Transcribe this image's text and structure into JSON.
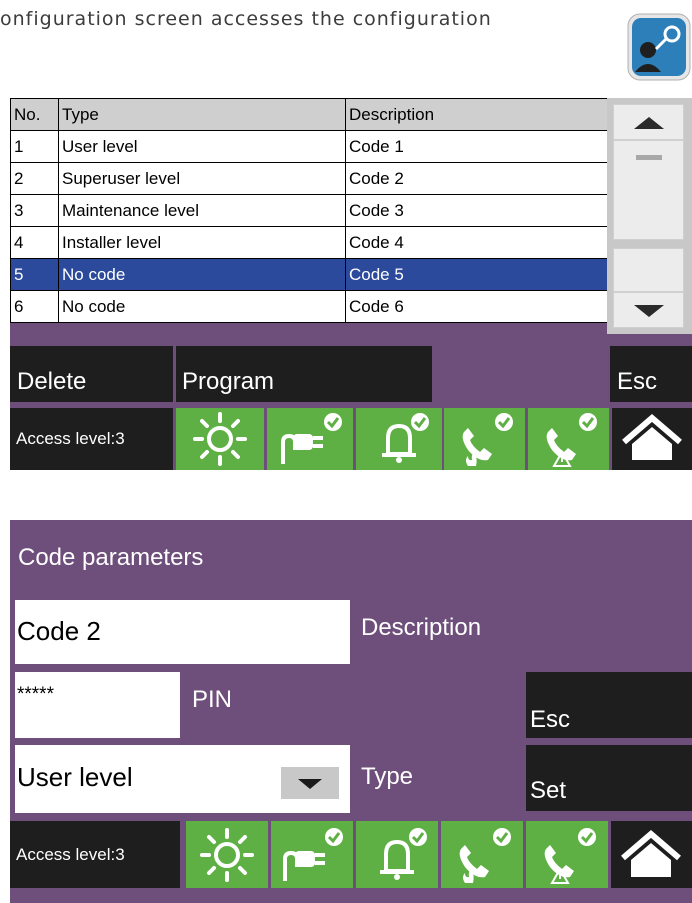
{
  "intro_text": "onfiguration screen accesses the configuration",
  "icons": {
    "header": "user-key-icon",
    "status": [
      "sun-icon",
      "power-plug-check-icon",
      "bell-check-icon",
      "phone-fire-check-icon",
      "phone-warning-check-icon"
    ],
    "home": "home-icon",
    "scroll_up": "triangle-up-icon",
    "scroll_down": "triangle-down-icon",
    "dropdown": "triangle-down-icon"
  },
  "code_table": {
    "columns": [
      "No.",
      "Type",
      "Description"
    ],
    "rows": [
      {
        "no": "1",
        "type": "User level",
        "description": "Code 1"
      },
      {
        "no": "2",
        "type": "Superuser level",
        "description": "Code 2"
      },
      {
        "no": "3",
        "type": "Maintenance level",
        "description": "Code 3"
      },
      {
        "no": "4",
        "type": "Installer level",
        "description": "Code 4"
      },
      {
        "no": "5",
        "type": "No code",
        "description": "Code 5",
        "selected": true
      },
      {
        "no": "6",
        "type": "No code",
        "description": "Code 6"
      }
    ],
    "delete_label": "Delete",
    "program_label": "Program",
    "esc_label": "Esc",
    "access_level": "Access level:3"
  },
  "code_parameters": {
    "title": "Code parameters",
    "description_value": "Code 2",
    "description_label": "Description",
    "pin_value": "*****",
    "pin_label": "PIN",
    "type_value": "User level",
    "type_label": "Type",
    "esc_label": "Esc",
    "set_label": "Set",
    "access_level": "Access level:3"
  },
  "colors": {
    "panel": "#6e4e7a",
    "button": "#1e1e1e",
    "status_green": "#5fb044",
    "selected_row": "#2b4a9c",
    "header_icon": "#2c7fb8"
  }
}
